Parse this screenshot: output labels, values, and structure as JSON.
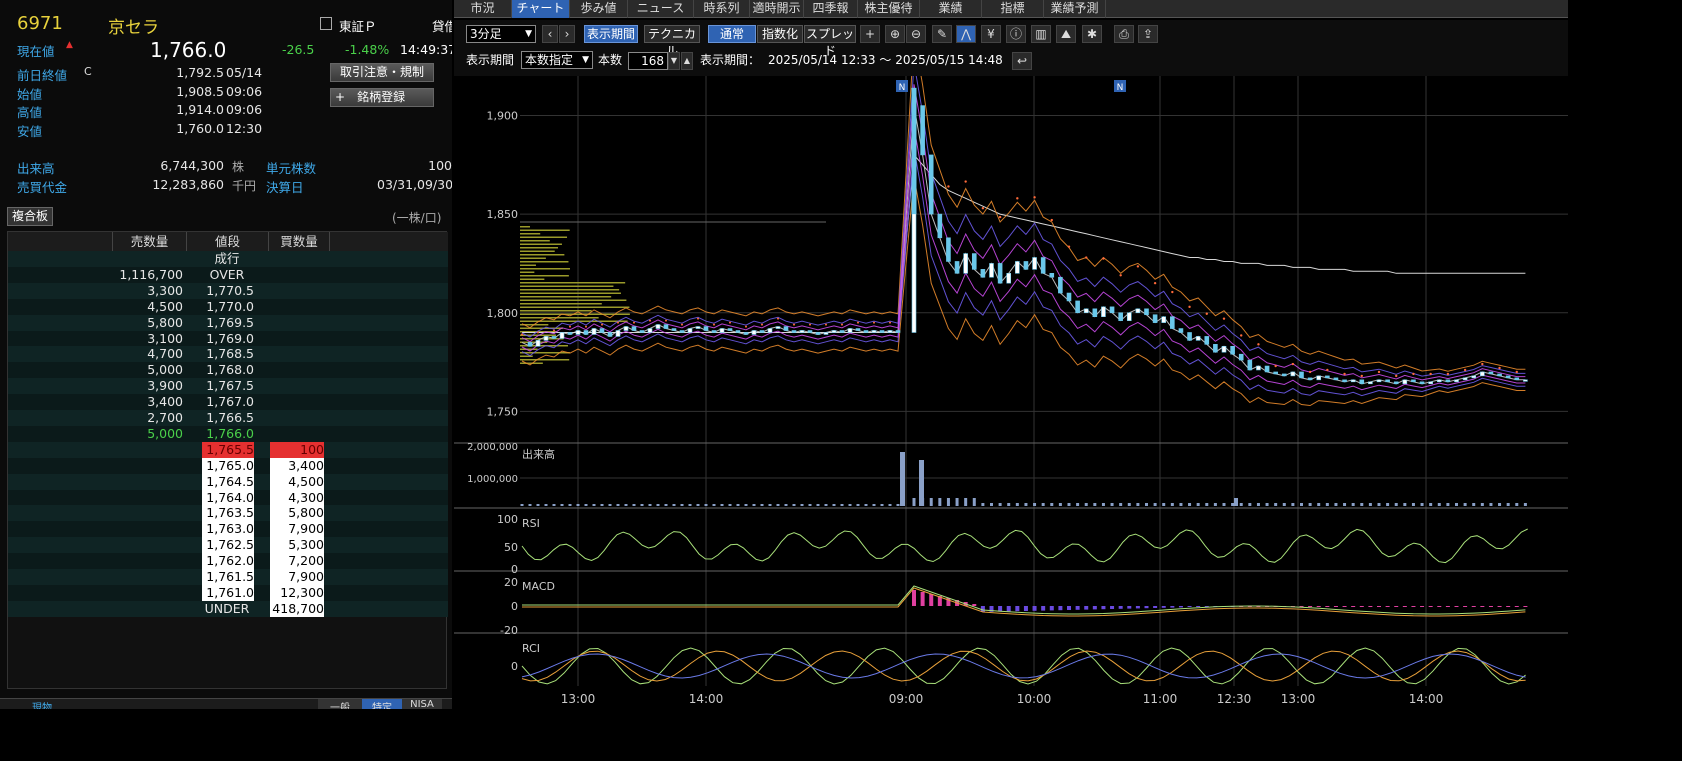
{
  "stock": {
    "code": "6971",
    "name": "京セラ",
    "market": "東証Ｐ",
    "lend_label": "貸借",
    "current_label": "現在値",
    "current_price": "1,766.0",
    "change": "-26.5",
    "change_pct": "-1.48%",
    "current_time": "14:49:37",
    "rows": [
      {
        "label": "前日終値",
        "flag": "C",
        "value": "1,792.5",
        "time": "05/14"
      },
      {
        "label": "始値",
        "flag": "",
        "value": "1,908.5",
        "time": "09:06"
      },
      {
        "label": "高値",
        "flag": "",
        "value": "1,914.0",
        "time": "09:06"
      },
      {
        "label": "安値",
        "flag": "",
        "value": "1,760.0",
        "time": "12:30"
      }
    ],
    "volume_label": "出来高",
    "volume": "6,744,300",
    "volume_unit": "株",
    "unit_shares_label": "単元株数",
    "unit_shares": "100",
    "turnover_label": "売買代金",
    "turnover": "12,283,860",
    "turnover_unit": "千円",
    "settle_label": "決算日",
    "settle": "03/31,09/30",
    "btn_notice": "取引注意・規制",
    "btn_register": "銘柄登録",
    "btn_register_icon": "plus-icon"
  },
  "book": {
    "tab_label": "複合板",
    "unit_note": "(一株/口)",
    "headers": [
      "売数量",
      "値段",
      "買数量"
    ],
    "rows": [
      {
        "sell": "",
        "price": "成行",
        "buy": "",
        "style": "center"
      },
      {
        "sell": "1,116,700",
        "price": "OVER",
        "buy": "",
        "style": "center"
      },
      {
        "sell": "3,300",
        "price": "1,770.5",
        "buy": ""
      },
      {
        "sell": "4,500",
        "price": "1,770.0",
        "buy": ""
      },
      {
        "sell": "5,800",
        "price": "1,769.5",
        "buy": ""
      },
      {
        "sell": "3,100",
        "price": "1,769.0",
        "buy": ""
      },
      {
        "sell": "4,700",
        "price": "1,768.5",
        "buy": ""
      },
      {
        "sell": "5,000",
        "price": "1,768.0",
        "buy": ""
      },
      {
        "sell": "3,900",
        "price": "1,767.5",
        "buy": ""
      },
      {
        "sell": "3,400",
        "price": "1,767.0",
        "buy": ""
      },
      {
        "sell": "2,700",
        "price": "1,766.5",
        "buy": ""
      },
      {
        "sell": "5,000",
        "price": "1,766.0",
        "buy": "",
        "style": "green"
      },
      {
        "sell": "",
        "price": "1,765.5",
        "buy": "100",
        "style": "red"
      },
      {
        "sell": "",
        "price": "1,765.0",
        "buy": "3,400",
        "style": "white"
      },
      {
        "sell": "",
        "price": "1,764.5",
        "buy": "4,500",
        "style": "white"
      },
      {
        "sell": "",
        "price": "1,764.0",
        "buy": "4,300",
        "style": "white"
      },
      {
        "sell": "",
        "price": "1,763.5",
        "buy": "5,800",
        "style": "white"
      },
      {
        "sell": "",
        "price": "1,763.0",
        "buy": "7,900",
        "style": "white"
      },
      {
        "sell": "",
        "price": "1,762.5",
        "buy": "5,300",
        "style": "white"
      },
      {
        "sell": "",
        "price": "1,762.0",
        "buy": "7,200",
        "style": "white"
      },
      {
        "sell": "",
        "price": "1,761.5",
        "buy": "7,900",
        "style": "white"
      },
      {
        "sell": "",
        "price": "1,761.0",
        "buy": "12,300",
        "style": "white"
      },
      {
        "sell": "",
        "price": "UNDER",
        "buy": "418,700",
        "style": "white-buy"
      }
    ],
    "footer_left": "現物",
    "footer_tabs": [
      "一般",
      "特定",
      "NISA"
    ]
  },
  "tabs": [
    "市況",
    "チャート",
    "歩み値",
    "ニュース",
    "時系列",
    "適時開示",
    "四季報",
    "株主優待",
    "業績",
    "指標",
    "業績予測"
  ],
  "active_tab": 1,
  "toolbar": {
    "interval": "3分足",
    "btn_period": "表示期間",
    "btn_technical": "テクニカル",
    "btn_normal": "通常",
    "btn_index": "指数化",
    "btn_spread": "スプレッド",
    "period_label": "表示期間",
    "period_mode": "本数指定",
    "bars_label": "本数",
    "bars_value": "168",
    "range_label": "表示期間：",
    "range_value": "2025/05/14 12:33 〜 2025/05/15 14:48",
    "icons": [
      "crosshair-icon",
      "zoom-in-icon",
      "zoom-out-icon",
      "pencil-icon",
      "line-tool-icon",
      "yen-icon",
      "info-icon",
      "bar-chart-icon",
      "mountain-icon",
      "wrench-icon",
      "print-icon",
      "export-icon"
    ]
  },
  "chart_data": {
    "type": "line",
    "price_axis": {
      "ticks": [
        "1,900",
        "1,850",
        "1,800",
        "1,750"
      ]
    },
    "volume_label": "出来高",
    "volume_ticks": [
      "2,000,000",
      "1,000,000"
    ],
    "rsi_label": "RSI",
    "rsi_ticks": [
      "100",
      "50",
      "0"
    ],
    "macd_label": "MACD",
    "macd_ticks": [
      "20",
      "0",
      "-20"
    ],
    "rci_label": "RCI",
    "rci_ticks": [
      "0"
    ],
    "x_ticks": [
      "13:00",
      "14:00",
      "09:00",
      "10:00",
      "11:00",
      "12:30",
      "13:00",
      "14:00"
    ],
    "news_marker": "N",
    "close": [
      1785,
      1783,
      1786,
      1788,
      1787,
      1790,
      1789,
      1791,
      1789,
      1792,
      1790,
      1788,
      1791,
      1793,
      1791,
      1790,
      1792,
      1794,
      1792,
      1791,
      1790,
      1792,
      1793,
      1791,
      1790,
      1792,
      1791,
      1790,
      1789,
      1791,
      1790,
      1792,
      1793,
      1791,
      1790,
      1791,
      1790,
      1789,
      1790,
      1791,
      1790,
      1792,
      1791,
      1790,
      1791,
      1790,
      1791,
      1790,
      1905,
      1880,
      1850,
      1838,
      1826,
      1820,
      1830,
      1822,
      1818,
      1825,
      1815,
      1820,
      1826,
      1822,
      1828,
      1820,
      1818,
      1810,
      1806,
      1800,
      1802,
      1798,
      1803,
      1800,
      1796,
      1800,
      1802,
      1799,
      1795,
      1798,
      1792,
      1790,
      1786,
      1788,
      1784,
      1780,
      1783,
      1779,
      1776,
      1771,
      1773,
      1770,
      1769,
      1768,
      1770,
      1767,
      1766,
      1768,
      1767,
      1766,
      1765,
      1766,
      1764,
      1765,
      1766,
      1765,
      1764,
      1766,
      1765,
      1764,
      1765,
      1766,
      1765,
      1766,
      1767,
      1768,
      1770,
      1769,
      1768,
      1767,
      1766,
      1766
    ],
    "sma_long": [
      1790,
      1790,
      1790,
      1790,
      1790,
      1790,
      1790,
      1790,
      1790,
      1790,
      1790,
      1790,
      1790,
      1790,
      1790,
      1790,
      1790,
      1790,
      1790,
      1790,
      1790,
      1790,
      1790,
      1790,
      1790,
      1790,
      1790,
      1790,
      1790,
      1790,
      1790,
      1790,
      1790,
      1790,
      1790,
      1790,
      1790,
      1790,
      1790,
      1790,
      1790,
      1790,
      1790,
      1790,
      1790,
      1790,
      1790,
      1790,
      1880,
      1875,
      1870,
      1865,
      1862,
      1860,
      1858,
      1856,
      1854,
      1852,
      1850,
      1849,
      1848,
      1847,
      1846,
      1845,
      1844,
      1843,
      1842,
      1841,
      1840,
      1839,
      1838,
      1837,
      1836,
      1835,
      1834,
      1833,
      1832,
      1831,
      1830,
      1829,
      1828,
      1828,
      1827,
      1827,
      1826,
      1826,
      1825,
      1825,
      1825,
      1824,
      1824,
      1824,
      1823,
      1823,
      1823,
      1822,
      1822,
      1822,
      1822,
      1821,
      1821,
      1821,
      1821,
      1821,
      1820,
      1820,
      1820,
      1820,
      1820,
      1820,
      1820,
      1820,
      1820,
      1820,
      1820,
      1820,
      1820,
      1820,
      1820,
      1820
    ]
  }
}
